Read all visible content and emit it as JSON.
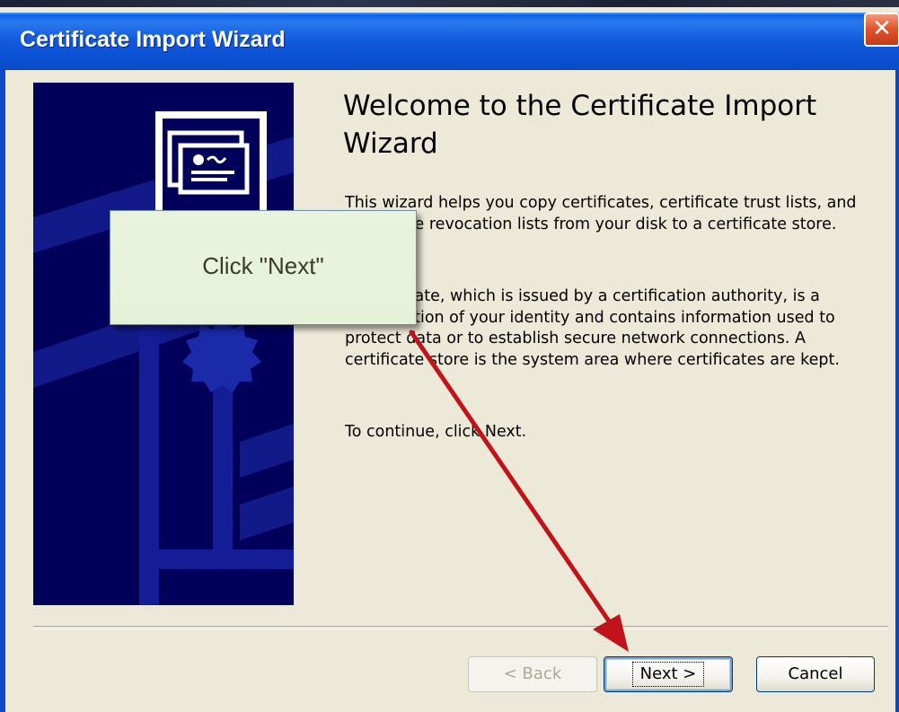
{
  "window": {
    "title": "Certificate Import Wizard",
    "close_symbol": "✕"
  },
  "content": {
    "heading": "Welcome to the Certificate Import Wizard",
    "paragraph1": "This wizard helps you copy certificates, certificate trust lists, and certificate revocation lists from your disk to a certificate store.",
    "paragraph2": "A certificate, which is issued by a certification authority, is a confirmation of your identity and contains information used to protect data or to establish secure network connections. A certificate store is the system area where certificates are kept.",
    "paragraph3": "To continue, click Next."
  },
  "buttons": {
    "back_label": "< Back",
    "next_label": "Next >",
    "cancel_label": "Cancel"
  },
  "annotation": {
    "callout_text": "Click \"Next\"",
    "arrow_color": "#c0141a"
  },
  "colors": {
    "titlebar": "#0a4fd0",
    "banner": "#00005a",
    "dialog_bg": "#ece9d8"
  },
  "icons": {
    "banner_illustration": "certificate-document-icon",
    "seal": "certificate-seal-icon"
  }
}
